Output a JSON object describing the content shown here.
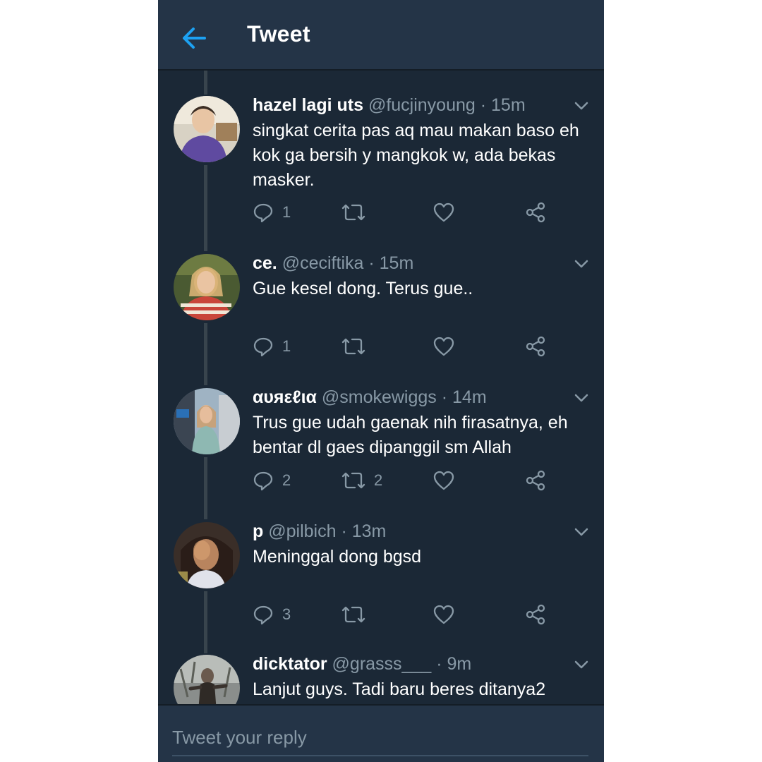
{
  "header": {
    "title": "Tweet",
    "back_icon": "arrow-left-icon",
    "accent_color": "#1da1f2"
  },
  "tweets": [
    {
      "name": "hazel lagi uts",
      "handle": "@fucjinyoung",
      "time": "· 15m",
      "text": "singkat cerita pas aq mau makan baso eh kok ga bersih y mangkok w, ada bekas masker.",
      "replies": "1",
      "retweets": "",
      "likes": ""
    },
    {
      "name": "ce.",
      "handle": "@ceciftika",
      "time": "· 15m",
      "text": "Gue kesel dong. Terus gue..",
      "replies": "1",
      "retweets": "",
      "likes": ""
    },
    {
      "name": "αυяεℓια",
      "handle": "@smokewiggs",
      "time": "· 14m",
      "text": "Trus gue udah gaenak nih firasatnya, eh bentar dl gaes dipanggil sm Allah",
      "replies": "2",
      "retweets": "2",
      "likes": ""
    },
    {
      "name": "p",
      "handle": "@pilbich",
      "time": "· 13m",
      "text": "Meninggal dong bgsd",
      "replies": "3",
      "retweets": "",
      "likes": ""
    },
    {
      "name": "dicktator",
      "handle": "@grasss___",
      "time": "· 9m",
      "text": "Lanjut guys. Tadi baru beres ditanya2",
      "replies": "",
      "retweets": "",
      "likes": ""
    }
  ],
  "reply_box": {
    "placeholder": "Tweet your reply"
  },
  "colors": {
    "background": "#1b2836",
    "header": "#243447",
    "secondary_text": "#8899a6",
    "thread_line": "#38444d"
  }
}
